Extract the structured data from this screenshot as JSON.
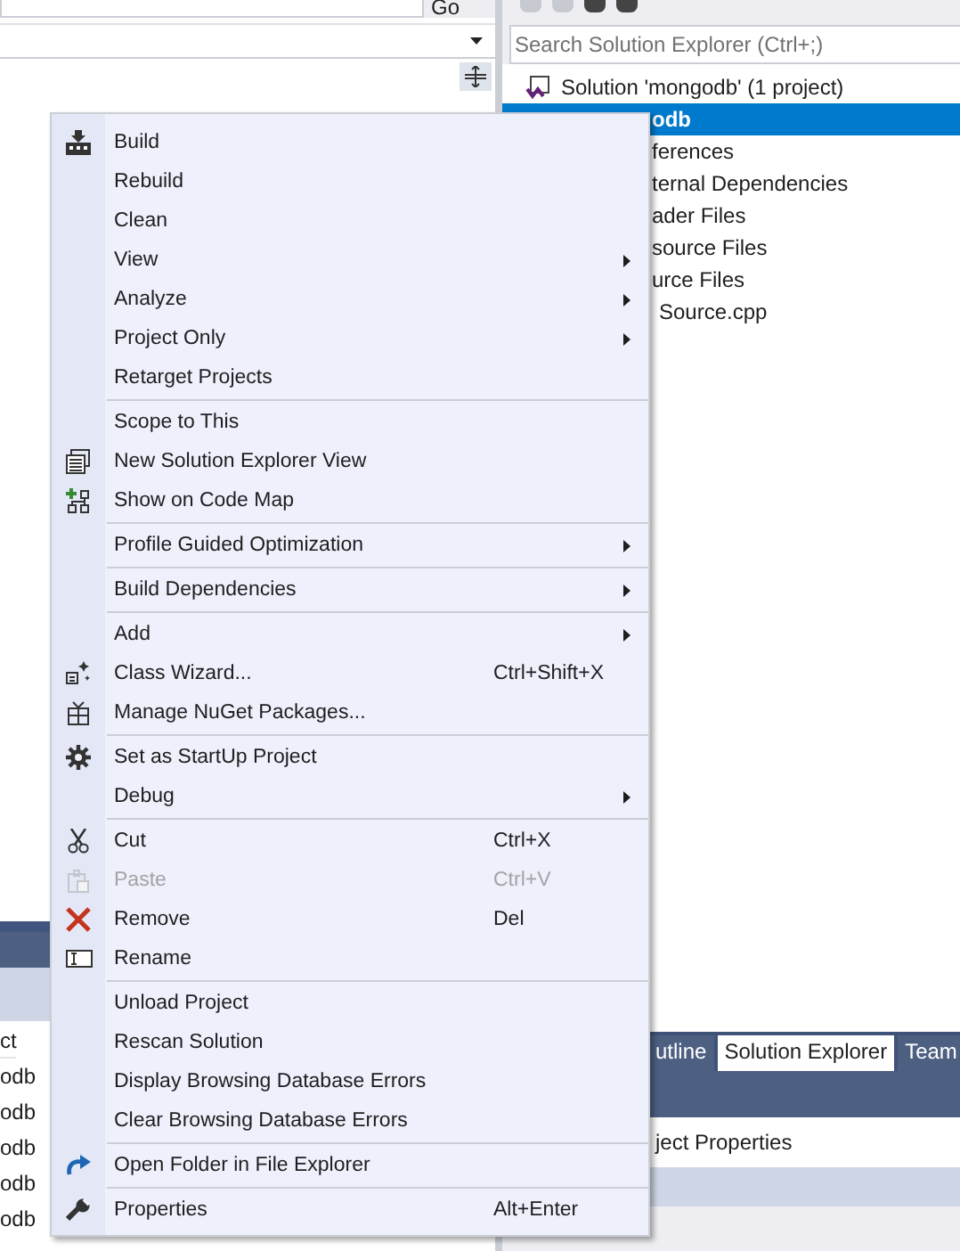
{
  "editor": {
    "go_button": "Go"
  },
  "bottom_panel": {
    "column_header": "ct",
    "rows": [
      "odb",
      "odb",
      "odb",
      "odb",
      "odb"
    ]
  },
  "solution_explorer": {
    "search": {
      "placeholder": "Search Solution Explorer (Ctrl+;)"
    },
    "tree": [
      {
        "label": "Solution 'mongodb' (1 project)",
        "selected": false,
        "kind": "solution"
      },
      {
        "label": "odb",
        "selected": true,
        "kind": "fragment"
      },
      {
        "label": "ferences",
        "selected": false,
        "kind": "fragment"
      },
      {
        "label": "ternal Dependencies",
        "selected": false,
        "kind": "fragment"
      },
      {
        "label": "ader Files",
        "selected": false,
        "kind": "fragment"
      },
      {
        "label": "source Files",
        "selected": false,
        "kind": "fragment"
      },
      {
        "label": "urce Files",
        "selected": false,
        "kind": "fragment"
      },
      {
        "label": "Source.cpp",
        "selected": false,
        "kind": "file"
      }
    ],
    "tabs": [
      {
        "label": "utline",
        "selected": false
      },
      {
        "label": "Solution Explorer",
        "selected": true
      },
      {
        "label": "Team",
        "selected": false
      }
    ],
    "properties_title": "ject Properties"
  },
  "context_menu": {
    "groups": [
      {
        "items": [
          {
            "label": "Build",
            "kind": "build",
            "submenu": false,
            "disabled": false
          },
          {
            "label": "Rebuild",
            "submenu": false,
            "disabled": false
          },
          {
            "label": "Clean",
            "submenu": false,
            "disabled": false
          },
          {
            "label": "View",
            "submenu": true,
            "disabled": false
          },
          {
            "label": "Analyze",
            "submenu": true,
            "disabled": false
          },
          {
            "label": "Project Only",
            "submenu": true,
            "disabled": false
          },
          {
            "label": "Retarget Projects",
            "submenu": false,
            "disabled": false
          }
        ]
      },
      {
        "items": [
          {
            "label": "Scope to This",
            "submenu": false,
            "disabled": false
          },
          {
            "label": "New Solution Explorer View",
            "kind": "window",
            "submenu": false,
            "disabled": false
          },
          {
            "label": "Show on Code Map",
            "kind": "codemap",
            "submenu": false,
            "disabled": false
          }
        ]
      },
      {
        "items": [
          {
            "label": "Profile Guided Optimization",
            "submenu": true,
            "disabled": false
          }
        ]
      },
      {
        "items": [
          {
            "label": "Build Dependencies",
            "submenu": true,
            "disabled": false
          }
        ]
      },
      {
        "items": [
          {
            "label": "Add",
            "submenu": true,
            "disabled": false
          },
          {
            "label": "Class Wizard...",
            "kind": "wizard",
            "shortcut": "Ctrl+Shift+X",
            "submenu": false,
            "disabled": false
          },
          {
            "label": "Manage NuGet Packages...",
            "kind": "package",
            "submenu": false,
            "disabled": false
          }
        ]
      },
      {
        "items": [
          {
            "label": "Set as StartUp Project",
            "kind": "gear",
            "submenu": false,
            "disabled": false
          },
          {
            "label": "Debug",
            "submenu": true,
            "disabled": false
          }
        ]
      },
      {
        "items": [
          {
            "label": "Cut",
            "kind": "scissors",
            "shortcut": "Ctrl+X",
            "submenu": false,
            "disabled": false
          },
          {
            "label": "Paste",
            "kind": "clipboard",
            "shortcut": "Ctrl+V",
            "submenu": false,
            "disabled": true
          },
          {
            "label": "Remove",
            "kind": "cross",
            "shortcut": "Del",
            "submenu": false,
            "disabled": false
          },
          {
            "label": "Rename",
            "kind": "rename",
            "submenu": false,
            "disabled": false
          }
        ]
      },
      {
        "items": [
          {
            "label": "Unload Project",
            "submenu": false,
            "disabled": false
          },
          {
            "label": "Rescan Solution",
            "submenu": false,
            "disabled": false
          },
          {
            "label": "Display Browsing Database Errors",
            "submenu": false,
            "disabled": false
          },
          {
            "label": "Clear Browsing Database Errors",
            "submenu": false,
            "disabled": false
          }
        ]
      },
      {
        "items": [
          {
            "label": "Open Folder in File Explorer",
            "kind": "redo",
            "submenu": false,
            "disabled": false
          }
        ]
      },
      {
        "items": [
          {
            "label": "Properties",
            "kind": "wrench",
            "shortcut": "Alt+Enter",
            "submenu": false,
            "disabled": false
          }
        ]
      }
    ]
  }
}
